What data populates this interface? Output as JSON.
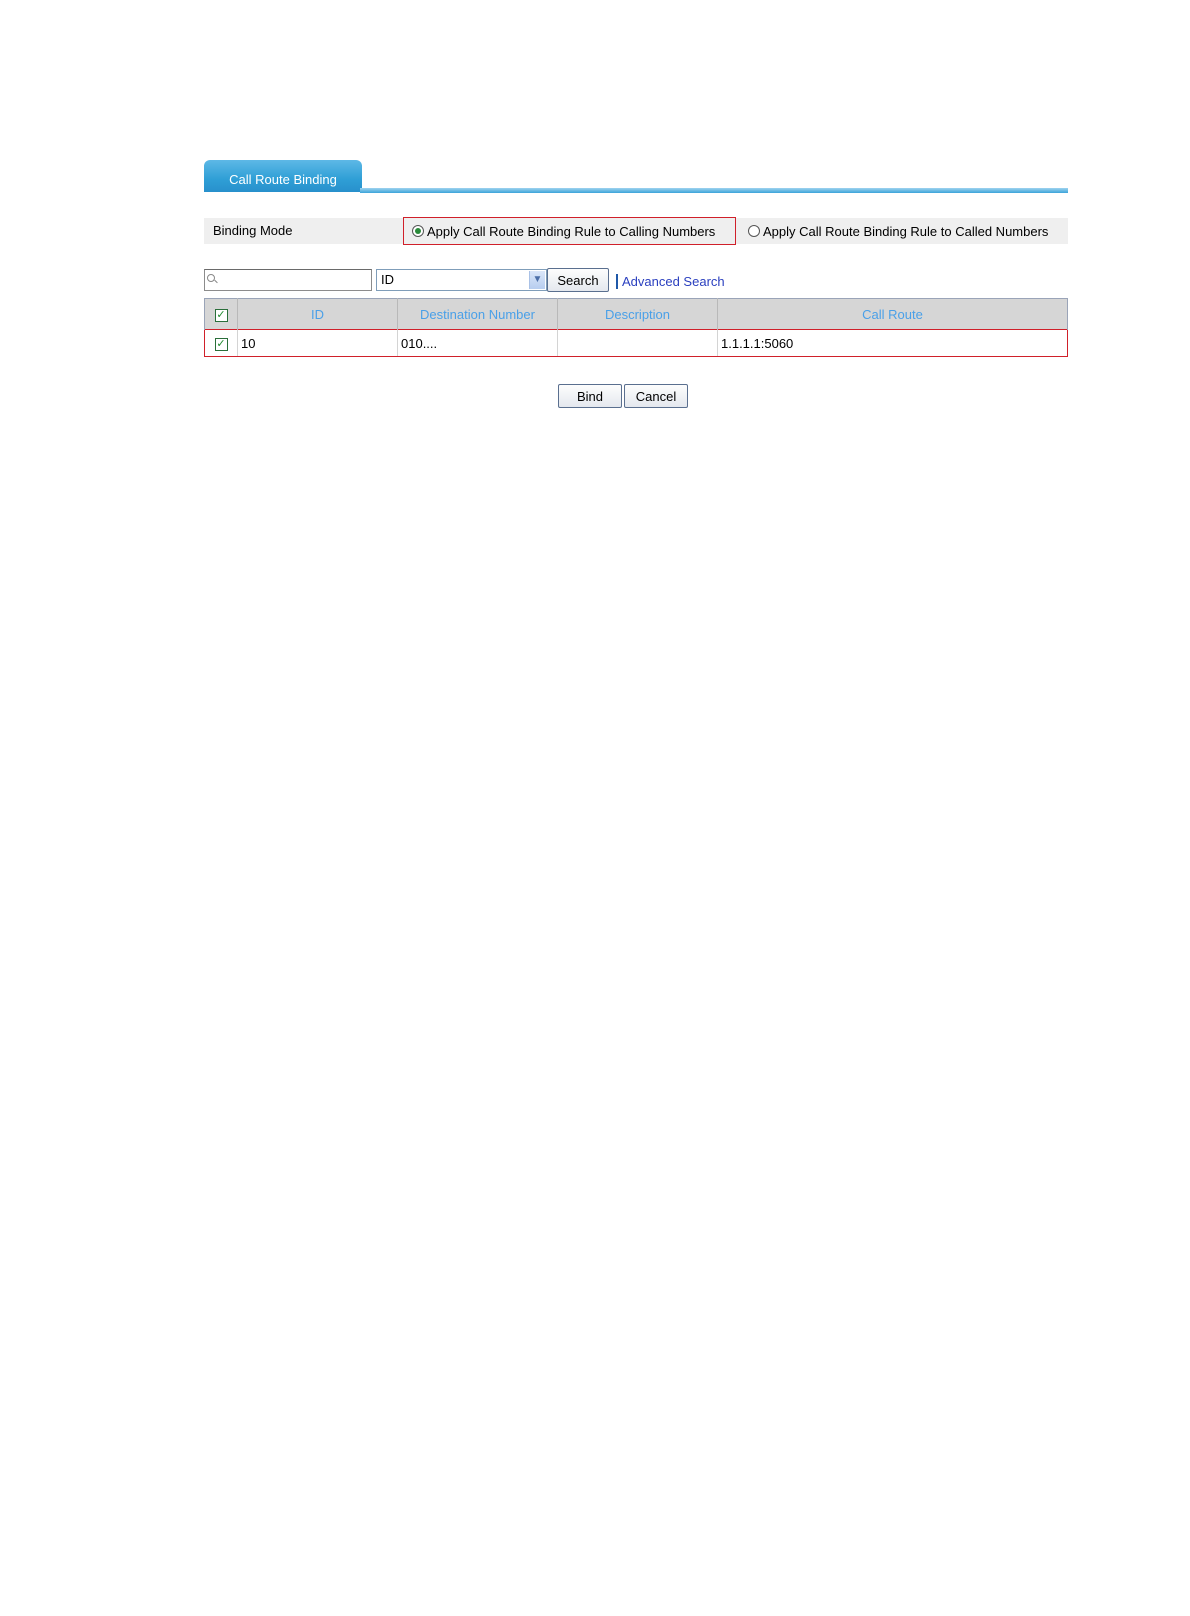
{
  "tab": {
    "label": "Call Route Binding"
  },
  "binding_mode": {
    "label": "Binding Mode",
    "options": [
      {
        "label": "Apply Call Route Binding Rule to Calling Numbers",
        "selected": true
      },
      {
        "label": "Apply Call Route Binding Rule to Called Numbers",
        "selected": false
      }
    ]
  },
  "search": {
    "input_value": "",
    "field_selected": "ID",
    "search_button": "Search",
    "advanced_link": "Advanced Search"
  },
  "table": {
    "headers": [
      "ID",
      "Destination Number",
      "Description",
      "Call Route"
    ],
    "header_checked": true,
    "rows": [
      {
        "checked": true,
        "id": "10",
        "destination_number": "010....",
        "description": "",
        "call_route": "1.1.1.1:5060"
      }
    ]
  },
  "actions": {
    "bind": "Bind",
    "cancel": "Cancel"
  },
  "colors": {
    "tab": "#2f9fd6",
    "header_text": "#4aa0e8",
    "highlight": "#d0202a",
    "link": "#2a3fbf"
  }
}
